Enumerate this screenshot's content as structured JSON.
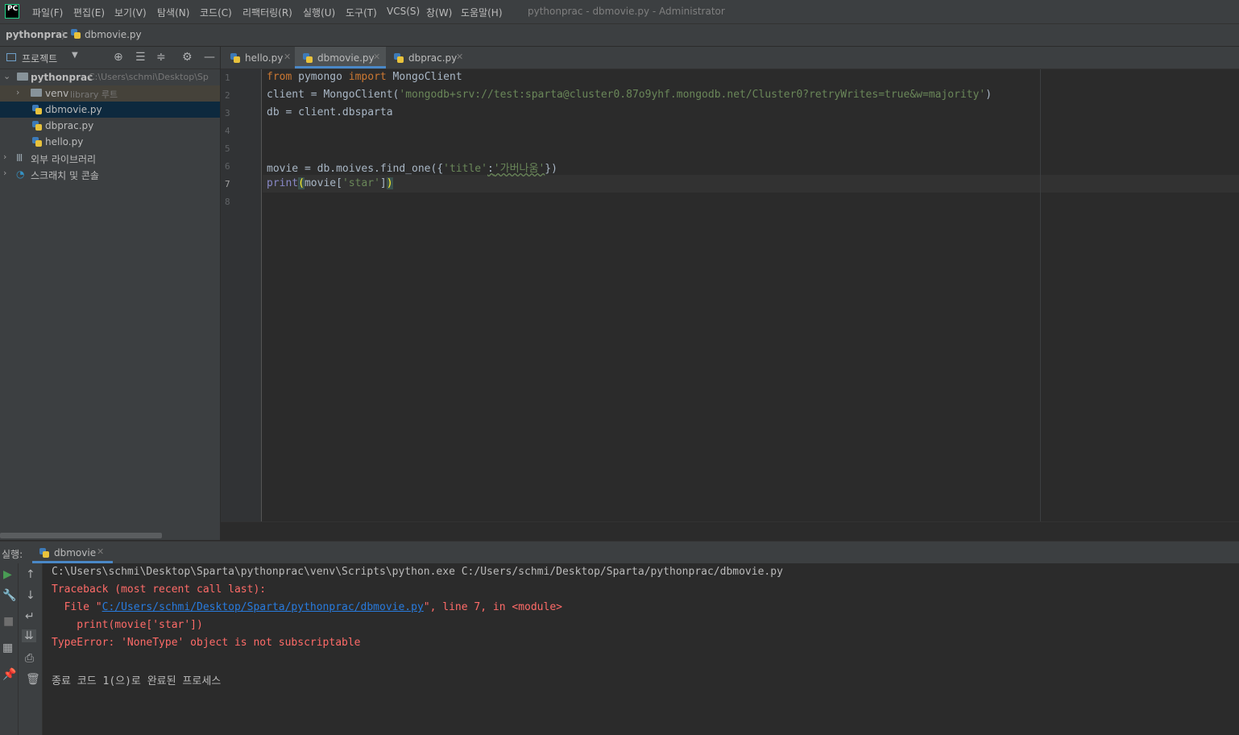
{
  "app": {
    "logo_text": "PC",
    "window_title": "pythonprac - dbmovie.py - Administrator"
  },
  "menu": [
    "파일(F)",
    "편집(E)",
    "보기(V)",
    "탐색(N)",
    "코드(C)",
    "리팩터링(R)",
    "실행(U)",
    "도구(T)",
    "VCS(S)",
    "창(W)",
    "도움말(H)"
  ],
  "navbar": {
    "project": "pythonprac",
    "separator": "〉",
    "file": "dbmovie.py"
  },
  "project_panel": {
    "title": "프로젝트",
    "tree": {
      "root_name": "pythonprac",
      "root_path": "C:\\Users\\schmi\\Desktop\\Sp",
      "venv_name": "venv",
      "venv_note": "library 루트",
      "files": [
        "dbmovie.py",
        "dbprac.py",
        "hello.py"
      ],
      "external_libs": "외부 라이브러리",
      "scratches": "스크래치 및 콘솔"
    }
  },
  "editor": {
    "tabs": [
      {
        "label": "hello.py",
        "active": false
      },
      {
        "label": "dbmovie.py",
        "active": true
      },
      {
        "label": "dbprac.py",
        "active": false
      }
    ],
    "line_numbers": [
      "1",
      "2",
      "3",
      "4",
      "5",
      "6",
      "7",
      "8"
    ],
    "current_line": 7,
    "code": {
      "l1_kw1": "from",
      "l1_mid": " pymongo ",
      "l1_kw2": "import",
      "l1_end": " MongoClient",
      "l2_start": "client = MongoClient(",
      "l2_str": "'mongodb+srv://test:sparta@cluster0.87o9yhf.mongodb.net/Cluster0?retryWrites=true&w=majority'",
      "l2_end": ")",
      "l3": "db = client.dbsparta",
      "l6_start": "movie = db.moives.find_one({",
      "l6_key": "'title'",
      "l6_colon": ":",
      "l6_val": "'가버나움'",
      "l6_end": "})",
      "l7_fn": "print",
      "l7_open": "(",
      "l7_mid": "movie[",
      "l7_str": "'star'",
      "l7_close_br": "]",
      "l7_close": ")"
    }
  },
  "run_panel": {
    "label": "실행:",
    "tab": "dbmovie",
    "console": {
      "cmd": "C:\\Users\\schmi\\Desktop\\Sparta\\pythonprac\\venv\\Scripts\\python.exe C:/Users/schmi/Desktop/Sparta/pythonprac/dbmovie.py",
      "traceback": "Traceback (most recent call last):",
      "file_prefix": "  File \"",
      "file_link": "C:/Users/schmi/Desktop/Sparta/pythonprac/dbmovie.py",
      "file_suffix": "\", line 7, in <module>",
      "code_line": "    print(movie['star'])",
      "error": "TypeError: 'NoneType' object is not subscriptable",
      "exit": "종료 코드 1(으)로 완료된 프로세스"
    }
  },
  "colors": {
    "accent": "#4a88c7",
    "error": "#ff6b68",
    "link": "#287bde",
    "keyword": "#cc7832",
    "string": "#6a8759"
  }
}
